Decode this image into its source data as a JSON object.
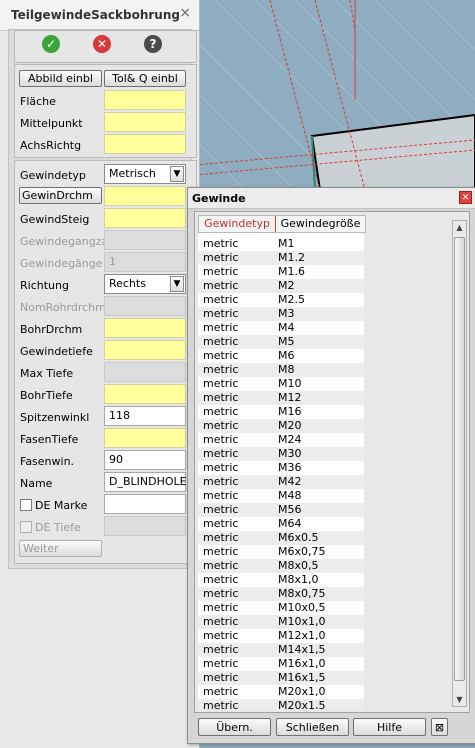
{
  "panel": {
    "title": "TeilgewindeSackbohrung",
    "close_glyph": "×",
    "ok_glyph": "✓",
    "cancel_glyph": "✕",
    "help_glyph": "?",
    "buttons": {
      "abbild": "Abbild einbl",
      "tolq": "Tol& Q einbl"
    },
    "labels": {
      "flaeche": "Fläche",
      "mittelpunkt": "Mittelpunkt",
      "achsrichtg": "AchsRichtg",
      "gewindetyp": "Gewindetyp",
      "gewindrdrchm": "GewinDrchm",
      "gewindsteig": "GewindSteig",
      "gewindegangzahl": "Gewindegangzahl",
      "gewindegaenge": "Gewindegänge",
      "richtung": "Richtung",
      "nomrohrdrchm": "NomRohrdrchm",
      "bohrdrchm": "BohrDrchm",
      "gewindetiefe": "Gewindetiefe",
      "maxtiefe": "Max Tiefe",
      "bohrtiefe": "BohrTiefe",
      "spitzenwinkl": "Spitzenwinkl",
      "fasentiefe": "FasenTiefe",
      "fasenwin": "Fasenwin.",
      "name": "Name",
      "demarke": "DE Marke",
      "detiefe": "DE Tiefe"
    },
    "values": {
      "gewindetyp": "Metrisch",
      "gewindegaenge": "1",
      "richtung": "Rechts",
      "spitzenwinkl": "118",
      "fasenwin": "90",
      "name": "D_BLINDHOLE"
    },
    "weiter": "Weiter"
  },
  "dialog": {
    "title": "Gewinde",
    "close_glyph": "✕",
    "headers": {
      "typ": "Gewindetyp",
      "size": "Gewindegröße"
    },
    "rows": [
      [
        "metric",
        "M1"
      ],
      [
        "metric",
        "M1.2"
      ],
      [
        "metric",
        "M1.6"
      ],
      [
        "metric",
        "M2"
      ],
      [
        "metric",
        "M2.5"
      ],
      [
        "metric",
        "M3"
      ],
      [
        "metric",
        "M4"
      ],
      [
        "metric",
        "M5"
      ],
      [
        "metric",
        "M6"
      ],
      [
        "metric",
        "M8"
      ],
      [
        "metric",
        "M10"
      ],
      [
        "metric",
        "M12"
      ],
      [
        "metric",
        "M16"
      ],
      [
        "metric",
        "M20"
      ],
      [
        "metric",
        "M24"
      ],
      [
        "metric",
        "M30"
      ],
      [
        "metric",
        "M36"
      ],
      [
        "metric",
        "M42"
      ],
      [
        "metric",
        "M48"
      ],
      [
        "metric",
        "M56"
      ],
      [
        "metric",
        "M64"
      ],
      [
        "metric",
        "M6x0.5"
      ],
      [
        "metric",
        "M6x0,75"
      ],
      [
        "metric",
        "M8x0,5"
      ],
      [
        "metric",
        "M8x1,0"
      ],
      [
        "metric",
        "M8x0,75"
      ],
      [
        "metric",
        "M10x0,5"
      ],
      [
        "metric",
        "M10x1,0"
      ],
      [
        "metric",
        "M12x1,0"
      ],
      [
        "metric",
        "M14x1,5"
      ],
      [
        "metric",
        "M16x1,0"
      ],
      [
        "metric",
        "M16x1,5"
      ],
      [
        "metric",
        "M20x1,0"
      ],
      [
        "metric",
        "M20x1,5"
      ]
    ],
    "buttons": {
      "uebern": "Übern.",
      "schliessen": "Schließen",
      "hilfe": "Hilfe",
      "pin": "⊠"
    },
    "scroll_up": "▲",
    "scroll_down": "▼"
  },
  "colors": {
    "canvas_bg": "#8eadc0",
    "highlight_red": "#e03030",
    "field_yellow": "#ffff9b"
  }
}
